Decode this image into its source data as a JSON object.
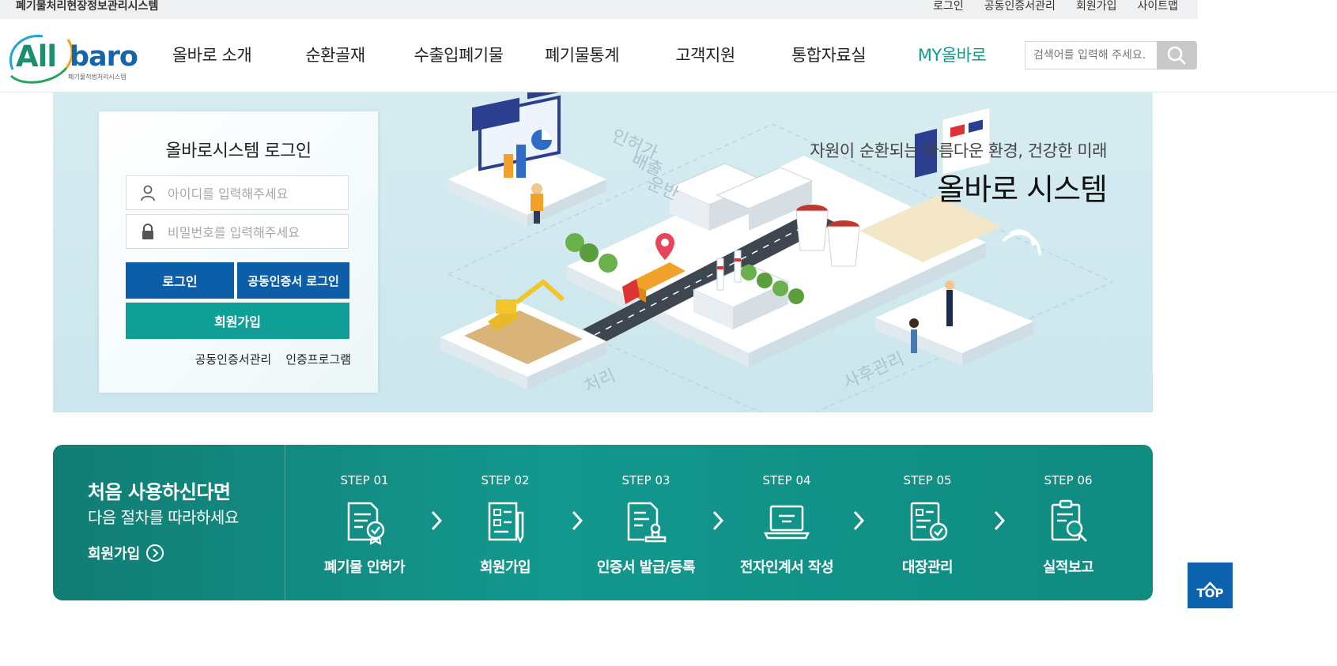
{
  "topbar": {
    "site_name": "폐기물처리현장정보관리시스템",
    "links": [
      "로그인",
      "공동인증서관리",
      "회원가입",
      "사이트맵"
    ]
  },
  "logo": {
    "text_all": "All",
    "text_baro": "baro",
    "subtitle": "폐기물적법처리시스템"
  },
  "nav": {
    "items": [
      "올바로 소개",
      "순환골재",
      "수출입폐기물",
      "폐기물통계",
      "고객지원",
      "통합자료실",
      "MY올바로"
    ],
    "active_color": "#119a87"
  },
  "search": {
    "placeholder": "검색어를 입력해 주세요.",
    "icon": "search-icon"
  },
  "login": {
    "title": "올바로시스템 로그인",
    "id_placeholder": "아이디를 입력해주세요",
    "pw_placeholder": "비밀번호를 입력해주세요",
    "login_label": "로그인",
    "cert_login_label": "공동인증서 로그인",
    "join_label": "회원가입",
    "links": [
      "공동인증서관리",
      "인증프로그램"
    ]
  },
  "hero": {
    "subtitle": "자원이 순환되는 아름다운 환경, 건강한 미래",
    "title": "올바로 시스템",
    "labels": [
      "인허가",
      "배출",
      "운반",
      "처리",
      "사후관리"
    ]
  },
  "steps": {
    "intro_title": "처음 사용하신다면",
    "intro_sub": "다음 절차를 따라하세요",
    "intro_link": "회원가입",
    "items": [
      {
        "num": "STEP 01",
        "label": "폐기물 인허가",
        "icon": "permit-document-icon"
      },
      {
        "num": "STEP 02",
        "label": "회원가입",
        "icon": "signup-form-icon"
      },
      {
        "num": "STEP 03",
        "label": "인증서 발급/등록",
        "icon": "certificate-stamp-icon"
      },
      {
        "num": "STEP 04",
        "label": "전자인계서 작성",
        "icon": "laptop-icon"
      },
      {
        "num": "STEP 05",
        "label": "대장관리",
        "icon": "ledger-check-icon"
      },
      {
        "num": "STEP 06",
        "label": "실적보고",
        "icon": "report-search-icon"
      }
    ]
  },
  "top_button": {
    "label": "TOP"
  },
  "colors": {
    "primary_blue": "#0c5ea8",
    "teal": "#0f9f97",
    "band": "#13988e"
  }
}
